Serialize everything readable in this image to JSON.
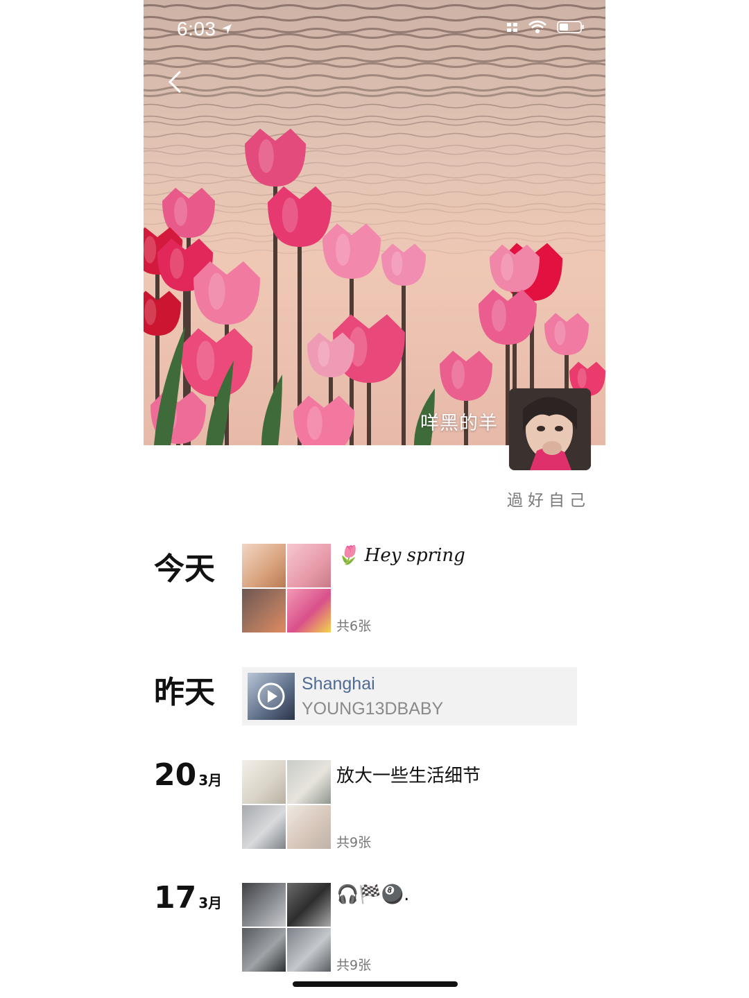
{
  "status_bar": {
    "time": "6:03"
  },
  "profile": {
    "nickname": "咩黑的羊",
    "signature": "過好自己"
  },
  "feed": [
    {
      "date_label": "今天",
      "text": "Hey spring",
      "emoji": "🌷",
      "photo_count": "共6张"
    },
    {
      "date_label": "昨天",
      "music_title": "Shanghai",
      "music_artist": "YOUNG13DBABY"
    },
    {
      "day": "20",
      "month": "3月",
      "text": "放大一些生活细节",
      "photo_count": "共9张"
    },
    {
      "day": "17",
      "month": "3月",
      "text": "🎧🏁🎱.",
      "photo_count": "共9张"
    }
  ],
  "colors": {
    "tulip_pink": "#f06a8f",
    "tulip_red": "#e0203f",
    "link_blue": "#4e6a95"
  }
}
